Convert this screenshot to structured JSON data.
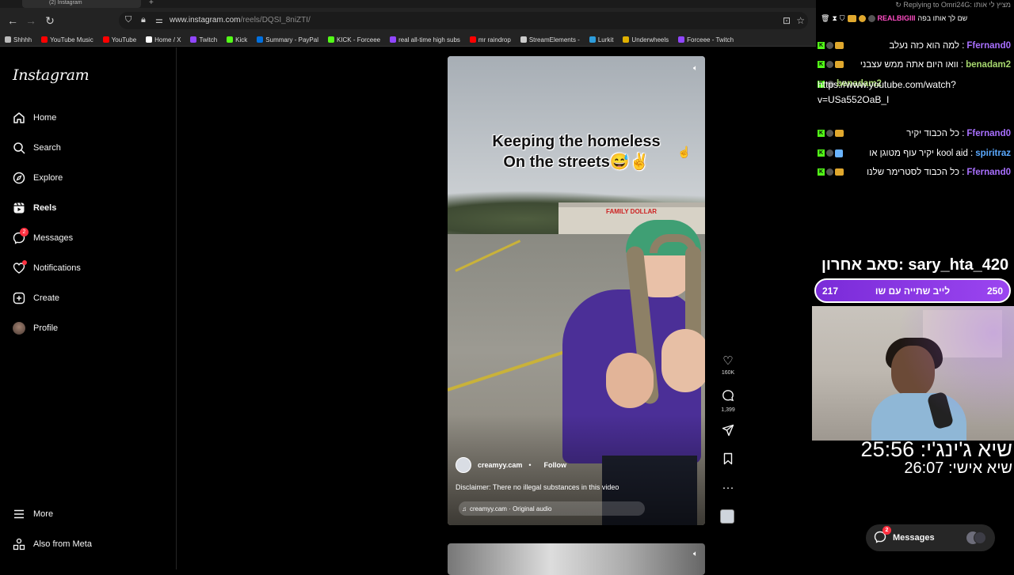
{
  "browser": {
    "tab_title": "(2) Instagram",
    "url_host": "www.instagram.com",
    "url_path": "/reels/DQSI_8niZTI/"
  },
  "bookmarks": [
    {
      "label": "Shhhh",
      "color": "#bbbbbb"
    },
    {
      "label": "YouTube Music",
      "color": "#ff0000"
    },
    {
      "label": "YouTube",
      "color": "#ff0000"
    },
    {
      "label": "Home / X",
      "color": "#ffffff"
    },
    {
      "label": "Twitch",
      "color": "#9146ff"
    },
    {
      "label": "Kick",
      "color": "#53fc18"
    },
    {
      "label": "Summary - PayPal",
      "color": "#0070e0"
    },
    {
      "label": "KICK - Forceee",
      "color": "#53fc18"
    },
    {
      "label": "real all-time high subs",
      "color": "#9146ff"
    },
    {
      "label": "mr raindrop",
      "color": "#ff0000"
    },
    {
      "label": "StreamElements -",
      "color": "#cccccc"
    },
    {
      "label": "Lurkit",
      "color": "#2d9cdb"
    },
    {
      "label": "Underwheels",
      "color": "#e0b000"
    },
    {
      "label": "Forceee - Twitch",
      "color": "#9146ff"
    }
  ],
  "sidebar": {
    "logo": "Instagram",
    "items": [
      {
        "label": "Home",
        "icon": "home-icon"
      },
      {
        "label": "Search",
        "icon": "search-icon"
      },
      {
        "label": "Explore",
        "icon": "compass-icon"
      },
      {
        "label": "Reels",
        "icon": "reels-icon"
      },
      {
        "label": "Messages",
        "icon": "messenger-icon",
        "badge": "2"
      },
      {
        "label": "Notifications",
        "icon": "heart-icon"
      },
      {
        "label": "Create",
        "icon": "plus-square-icon"
      },
      {
        "label": "Profile",
        "icon": "avatar"
      }
    ],
    "more": "More",
    "also_from_meta": "Also from Meta"
  },
  "reel": {
    "caption_line1": "Keeping the homeless",
    "caption_line2": "On the streets😅✌️",
    "store_sign": "FAMILY DOLLAR",
    "author": "creamyy.cam",
    "follow": "Follow",
    "separator": "•",
    "description": "Disclaimer: There no illegal substances in this video",
    "audio": "creamyy.cam · Original audio",
    "likes": "160K",
    "comments": "1,399"
  },
  "chat": {
    "reply_header": "Replying to Omri24G: מציץ לי אותו",
    "reply_msg_user": "REALBIGIII",
    "reply_msg_text": "שם לך אותו בפה",
    "lines": [
      {
        "user": "Ffernand0",
        "text": "למה הוא כזה נעלב :",
        "color": "#a970ff"
      },
      {
        "user": "benadam2",
        "text": "וואו היום אתה ממש עצבני :",
        "color": "#a7d86e"
      },
      {
        "user": "benadam2",
        "text": ":",
        "color": "#a7d86e"
      },
      {
        "user": "Ffernand0",
        "text": "כל הכבוד יקיר :",
        "color": "#a970ff"
      },
      {
        "user": "spiritraz",
        "text": "יקיר עוף מטוגן או kool aid :",
        "color": "#5aa9ff"
      },
      {
        "user": "Ffernand0",
        "text": "כל הכבוד לסטרימר שלנו :",
        "color": "#a970ff"
      }
    ],
    "link": "https://www.youtube.com/watch?v=USa552OaB_I"
  },
  "overlay": {
    "last_sub": "סאב אחרון: sary_hta_420",
    "goal_current": "217",
    "goal_label": "לייב שתייה עם שו",
    "goal_target": "250",
    "timer_ginger": "שיא ג'ינג'י: 25:56",
    "timer_personal": "שיא אישי: 26:07"
  },
  "messages_pill": {
    "label": "Messages",
    "badge": "2"
  },
  "colors": {
    "ig_background": "#000000",
    "notification_red": "#ff3040",
    "goal_purple": "#9b45f0",
    "kick_green": "#53fc18"
  }
}
